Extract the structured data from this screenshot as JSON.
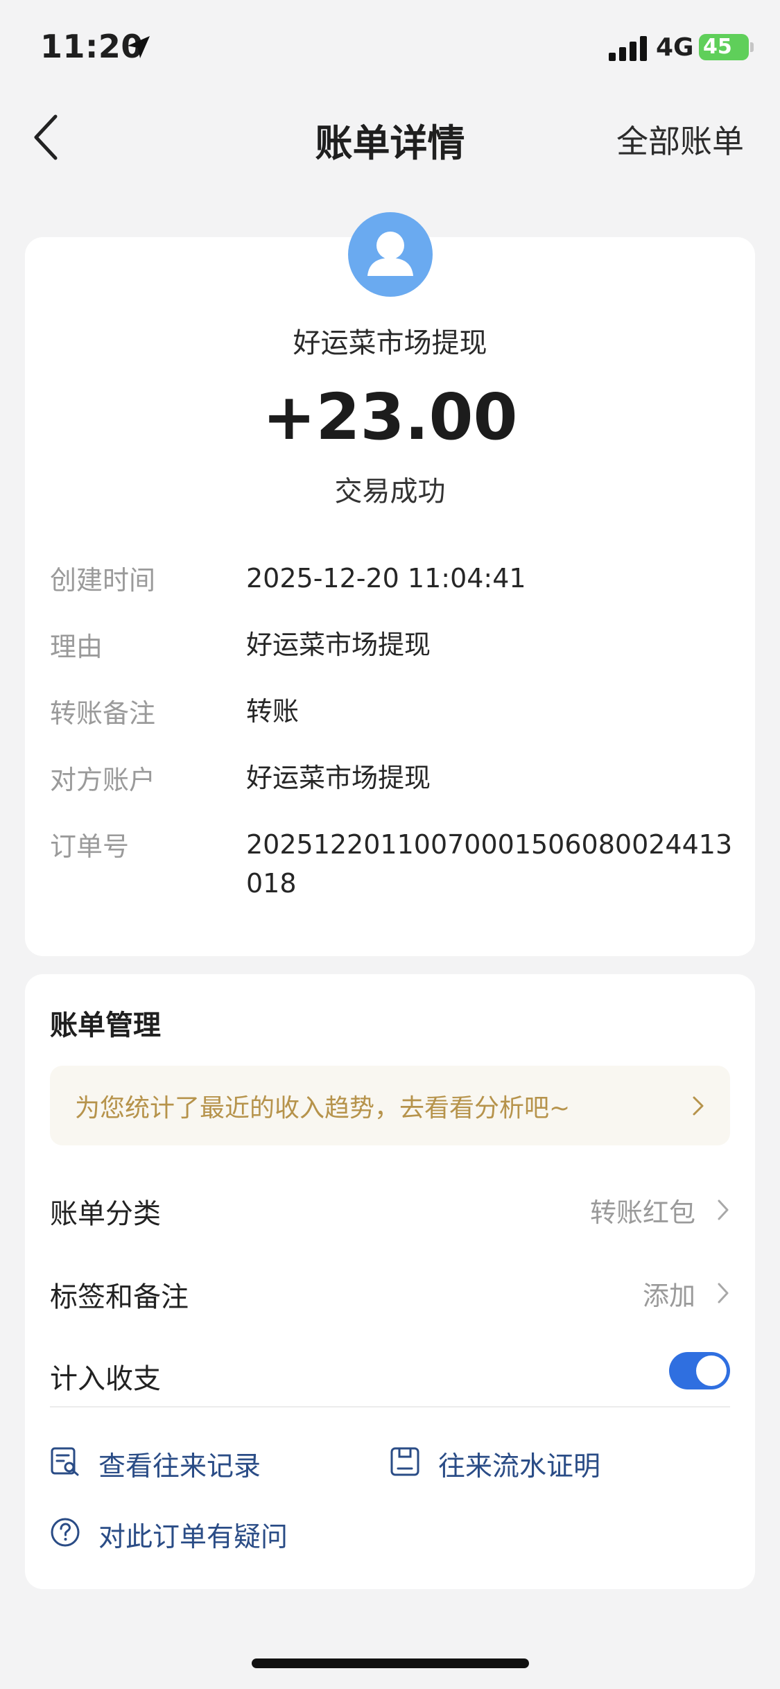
{
  "status_bar": {
    "time": "11:20",
    "network": "4G",
    "battery": "45"
  },
  "nav": {
    "title": "账单详情",
    "right_action": "全部账单"
  },
  "transaction": {
    "merchant": "好运菜市场提现",
    "amount": "+23.00",
    "status": "交易成功"
  },
  "details": [
    {
      "label": "创建时间",
      "value": "2025-12-20 11:04:41"
    },
    {
      "label": "理由",
      "value": "好运菜市场提现"
    },
    {
      "label": "转账备注",
      "value": "转账"
    },
    {
      "label": "对方账户",
      "value": "好运菜市场提现"
    },
    {
      "label": "订单号",
      "value": "20251220110070001506080024413018"
    }
  ],
  "manage": {
    "title": "账单管理",
    "tip": "为您统计了最近的收入趋势，去看看分析吧~",
    "category_label": "账单分类",
    "category_value": "转账红包",
    "tags_label": "标签和备注",
    "tags_value": "添加",
    "include_label": "计入收支",
    "include_enabled": true
  },
  "actions": {
    "records": "查看往来记录",
    "proof": "往来流水证明",
    "question": "对此订单有疑问"
  },
  "colors": {
    "accent": "#2f6fe0",
    "avatar": "#6aaaf0",
    "tip_text": "#b6934b",
    "action_text": "#2a4c86",
    "battery": "#5fcf5a"
  }
}
